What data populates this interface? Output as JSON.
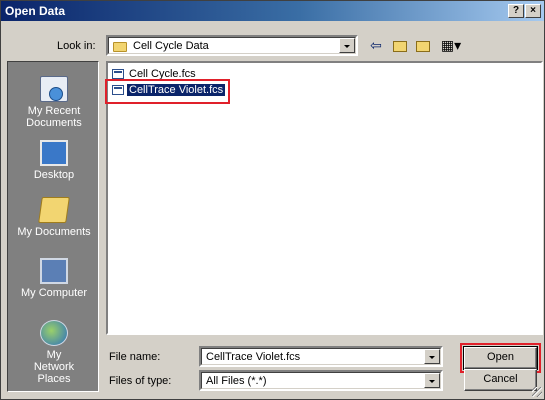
{
  "window": {
    "title": "Open Data",
    "help_label": "?",
    "close_label": "×"
  },
  "lookin": {
    "label": "Look in:",
    "value": "Cell Cycle Data"
  },
  "toolbar": {
    "back_glyph": "⇦",
    "views_glyph": "▦▾"
  },
  "places": [
    {
      "label": "My Recent Documents",
      "icon": "recent-documents-icon"
    },
    {
      "label": "Desktop",
      "icon": "desktop-icon"
    },
    {
      "label": "My Documents",
      "icon": "my-documents-icon"
    },
    {
      "label": "My Computer",
      "icon": "my-computer-icon"
    },
    {
      "label": "My Network Places",
      "icon": "network-places-icon"
    }
  ],
  "files": [
    {
      "name": "Cell Cycle.fcs",
      "selected": false
    },
    {
      "name": "CellTrace Violet.fcs",
      "selected": true
    }
  ],
  "form": {
    "filename_label": "File name:",
    "filename_value": "CellTrace Violet.fcs",
    "filetype_label": "Files of type:",
    "filetype_value": "All Files (*.*)"
  },
  "buttons": {
    "open": "Open",
    "cancel": "Cancel"
  },
  "colors": {
    "title_bar": "#0a246a",
    "selection": "#0a246a",
    "highlight_box": "#e0202a",
    "places_bar": "#808080"
  }
}
